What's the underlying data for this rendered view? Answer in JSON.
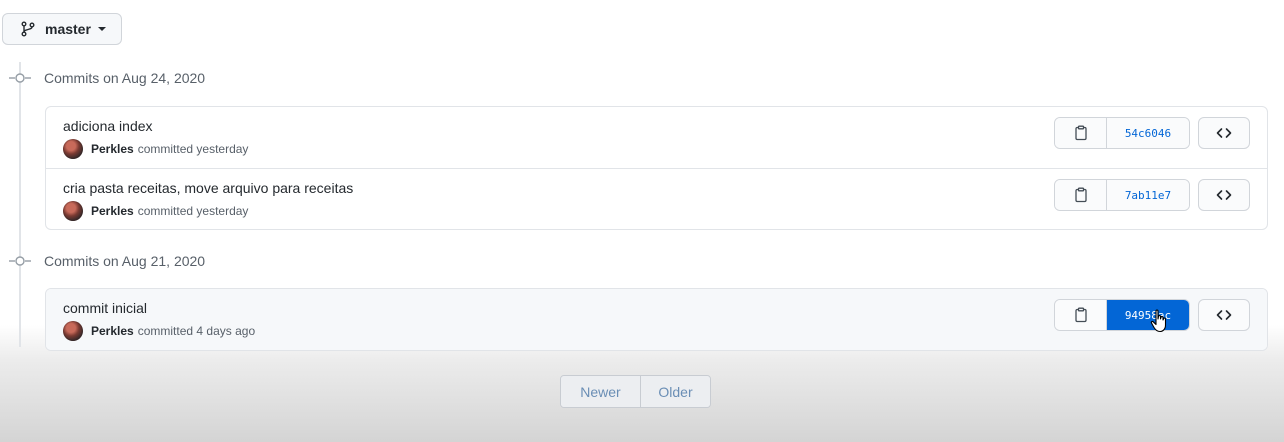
{
  "branch": {
    "name": "master",
    "icon": "git-branch-icon"
  },
  "groups": [
    {
      "title": "Commits on Aug 24, 2020",
      "commits": [
        {
          "message": "adiciona index",
          "author": "Perkles",
          "action": "committed",
          "time": "yesterday",
          "sha": "54c6046",
          "active": false
        },
        {
          "message": "cria pasta receitas, move arquivo para receitas",
          "author": "Perkles",
          "action": "committed",
          "time": "yesterday",
          "sha": "7ab11e7",
          "active": false
        }
      ]
    },
    {
      "title": "Commits on Aug 21, 2020",
      "commits": [
        {
          "message": "commit inicial",
          "author": "Perkles",
          "action": "committed",
          "time": "4 days ago",
          "sha": "94958ac",
          "active": true
        }
      ]
    }
  ],
  "pagination": {
    "newer": "Newer",
    "older": "Older"
  },
  "colors": {
    "accent": "#0366d6",
    "border": "#e1e4e8",
    "muted_text": "#586069"
  }
}
